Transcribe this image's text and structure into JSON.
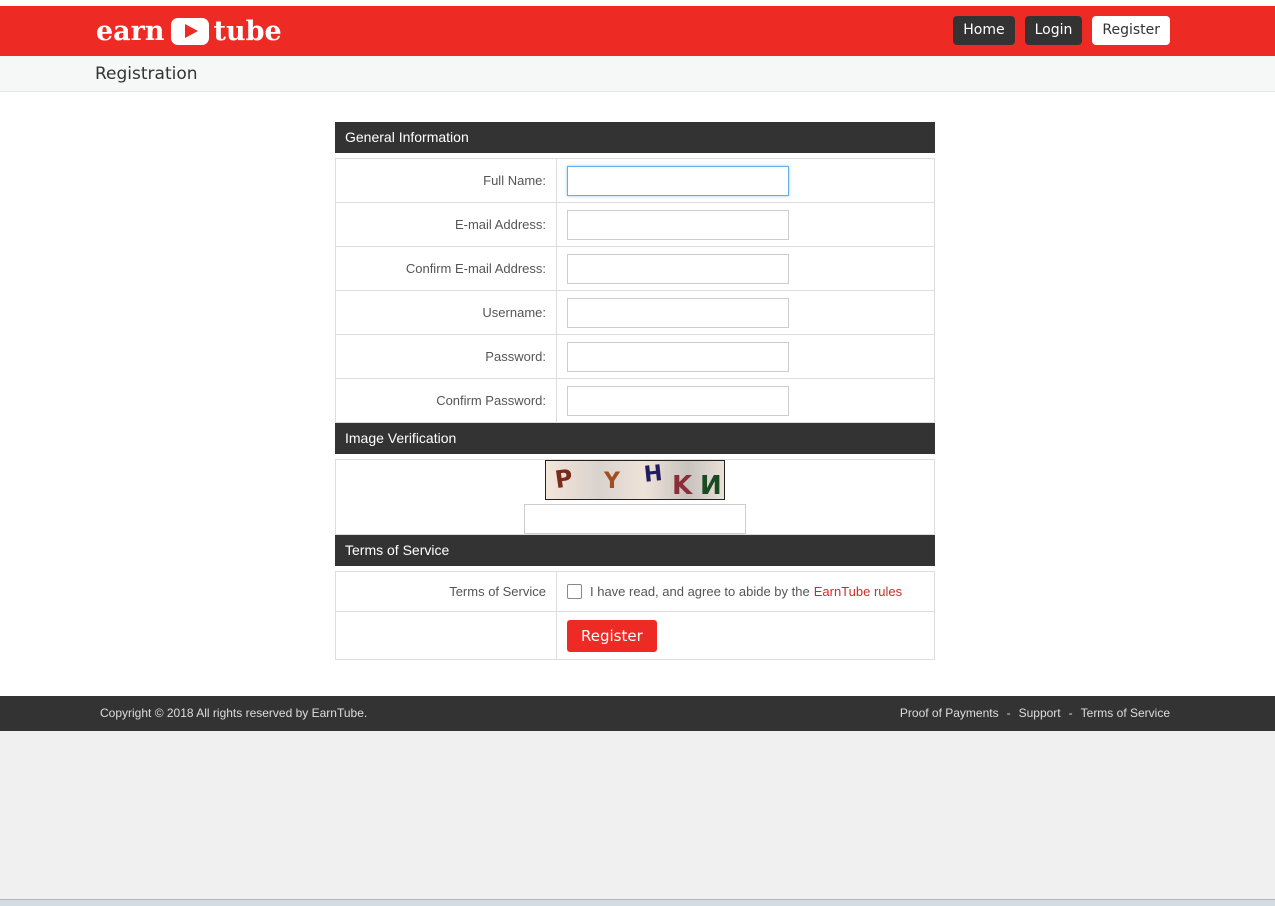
{
  "brand": {
    "left": "earn",
    "right": "tube"
  },
  "nav": {
    "home": "Home",
    "login": "Login",
    "register": "Register"
  },
  "page_title": "Registration",
  "sections": {
    "general": "General Information",
    "image": "Image Verification",
    "terms": "Terms of Service"
  },
  "fields": {
    "full_name": "Full Name:",
    "email": "E-mail Address:",
    "confirm_email": "Confirm E-mail Address:",
    "username": "Username:",
    "password": "Password:",
    "confirm_password": "Confirm Password:"
  },
  "captcha": {
    "letters": [
      "P",
      "Y",
      "H",
      "K",
      "N"
    ]
  },
  "terms": {
    "label": "Terms of Service",
    "agree_text": "I have read, and agree to abide by the",
    "rules_link": "EarnTube rules"
  },
  "register_button": "Register",
  "footer": {
    "copyright": "Copyright © 2018 All rights reserved by EarnTube.",
    "links": [
      "Proof of Payments",
      "Support",
      "Terms of Service"
    ],
    "separator": "-"
  },
  "colors": {
    "brand_red": "#ed2a24",
    "dark": "#333333",
    "link_red": "#d42b27"
  }
}
